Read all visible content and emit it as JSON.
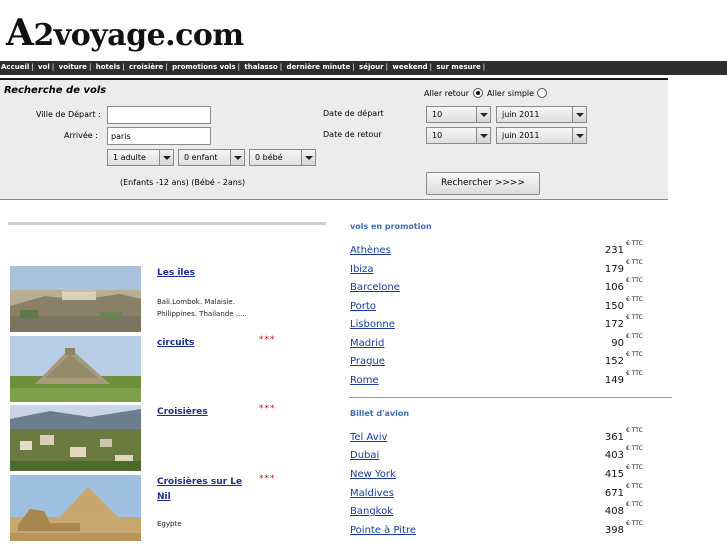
{
  "logo": {
    "first": "A",
    "rest": "2voyage.com"
  },
  "nav": [
    "Accueil",
    "vol",
    "voiture",
    "hotels",
    "croisière",
    "promotions vols",
    "thalasso",
    "dernière minute",
    "séjour",
    "weekend",
    "sur mesure"
  ],
  "search": {
    "title": "Recherche de vols",
    "depart_label": "Ville de Départ :",
    "depart_value": "",
    "arrivee_label": "Arrivée :",
    "arrivee_value": "paris",
    "adults": "1 adulte",
    "children": "0 enfant",
    "babies": "0 bébé",
    "ages_note": "(Enfants -12 ans) (Bébé - 2ans)",
    "aller_retour": "Aller retour",
    "aller_simple": "Aller simple",
    "date_depart_label": "Date de départ",
    "date_retour_label": "Date de retour",
    "depart_day": "10",
    "depart_month": "juin 2011",
    "retour_day": "10",
    "retour_month": "juin 2011",
    "submit": "Rechercher  >>>>"
  },
  "destinations": [
    {
      "title": "Les îles",
      "stars": "",
      "desc1": "Bali.Lombok. Malaisie.",
      "desc2": "Philippines. Thailande ....."
    },
    {
      "title": "circuits",
      "stars": "***",
      "desc1": "",
      "desc2": ""
    },
    {
      "title": "Croisières",
      "stars": "***",
      "desc1": "",
      "desc2": ""
    },
    {
      "title": "Croisières sur Le",
      "title2": "Nil",
      "stars": "***",
      "desc1": "Egypte",
      "desc2": ""
    }
  ],
  "promo": {
    "title": "vols en promotion",
    "items": [
      {
        "city": "Athènes",
        "price": "231",
        "unit": "€ TTC"
      },
      {
        "city": "Ibiza",
        "price": "179",
        "unit": "€ TTC"
      },
      {
        "city": "Barcelone",
        "price": "106",
        "unit": "€ TTC"
      },
      {
        "city": "Porto",
        "price": "150",
        "unit": "€ TTC"
      },
      {
        "city": "Lisbonne",
        "price": "172",
        "unit": "€ TTC"
      },
      {
        "city": "Madrid",
        "price": "90",
        "unit": "€ TTC"
      },
      {
        "city": "Prague",
        "price": "152",
        "unit": "€ TTC"
      },
      {
        "city": "Rome",
        "price": "149",
        "unit": "€ TTC"
      }
    ]
  },
  "billet": {
    "title": "Billet d'avion",
    "items": [
      {
        "city": "Tel Aviv",
        "price": "361",
        "unit": "€ TTC"
      },
      {
        "city": "Dubai",
        "price": "403",
        "unit": "€ TTC"
      },
      {
        "city": "New York",
        "price": "415",
        "unit": "€ TTC"
      },
      {
        "city": "Maldives",
        "price": "671",
        "unit": "€ TTC"
      },
      {
        "city": "Bangkok",
        "price": "408",
        "unit": "€ TTC"
      },
      {
        "city": "Pointe à Pitre",
        "price": "398",
        "unit": "€ TTC"
      }
    ]
  }
}
